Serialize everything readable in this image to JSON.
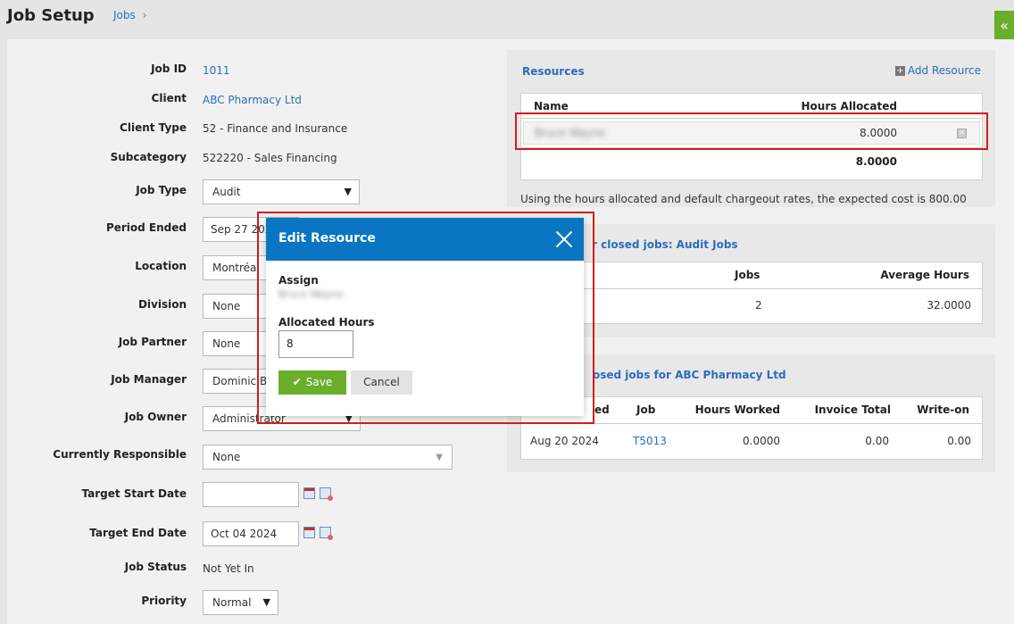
{
  "header": {
    "title": "Job Setup",
    "breadcrumb": "Jobs",
    "breadcrumb_sep": "›",
    "collapse_glyph": "«"
  },
  "form": {
    "job_id": {
      "label": "Job ID",
      "value": "1011"
    },
    "client": {
      "label": "Client",
      "value": "ABC Pharmacy Ltd"
    },
    "client_type": {
      "label": "Client Type",
      "value": "52 - Finance and Insurance"
    },
    "subcategory": {
      "label": "Subcategory",
      "value": "522220 - Sales Financing"
    },
    "job_type": {
      "label": "Job Type",
      "value": "Audit"
    },
    "period_ended": {
      "label": "Period Ended",
      "value": "Sep 27 2024"
    },
    "location": {
      "label": "Location",
      "value": "Montréal"
    },
    "division": {
      "label": "Division",
      "value": "None"
    },
    "job_partner": {
      "label": "Job Partner",
      "value": "None"
    },
    "job_manager": {
      "label": "Job Manager",
      "value": "Dominic B"
    },
    "job_owner": {
      "label": "Job Owner",
      "value": "Administrator"
    },
    "currently_responsible": {
      "label": "Currently Responsible",
      "value": "None"
    },
    "target_start": {
      "label": "Target Start Date",
      "value": ""
    },
    "target_end": {
      "label": "Target End Date",
      "value": "Oct 04 2024"
    },
    "job_status": {
      "label": "Job Status",
      "value": "Not Yet In"
    },
    "priority": {
      "label": "Priority",
      "value": "Normal"
    }
  },
  "resources": {
    "title": "Resources",
    "add_label": "Add Resource",
    "col_name": "Name",
    "col_hours": "Hours Allocated",
    "row_name": "Bruce Wayne",
    "row_hours": "8.0000",
    "total": "8.0000",
    "note": "Using the hours allocated and default chargeout rates, the expected cost is 800.00"
  },
  "closed_jobs": {
    "title": "r closed jobs: Audit Jobs",
    "col_jobs": "Jobs",
    "col_avg": "Average Hours",
    "jobs": "2",
    "avg": "32.0000"
  },
  "client_jobs": {
    "title": "osed jobs for ABC Pharmacy Ltd",
    "col_ended": "ed",
    "col_job": "Job",
    "col_hours": "Hours Worked",
    "col_invoice": "Invoice Total",
    "col_writeon": "Write-on",
    "row": {
      "date": "Aug 20 2024",
      "job": "T5013",
      "hours": "0.0000",
      "invoice": "0.00",
      "writeon": "0.00"
    }
  },
  "modal": {
    "title": "Edit Resource",
    "assign_label": "Assign",
    "assign_value": "Bruce Wayne",
    "hours_label": "Allocated Hours",
    "hours_value": "8",
    "save_label": "Save",
    "cancel_label": "Cancel"
  }
}
